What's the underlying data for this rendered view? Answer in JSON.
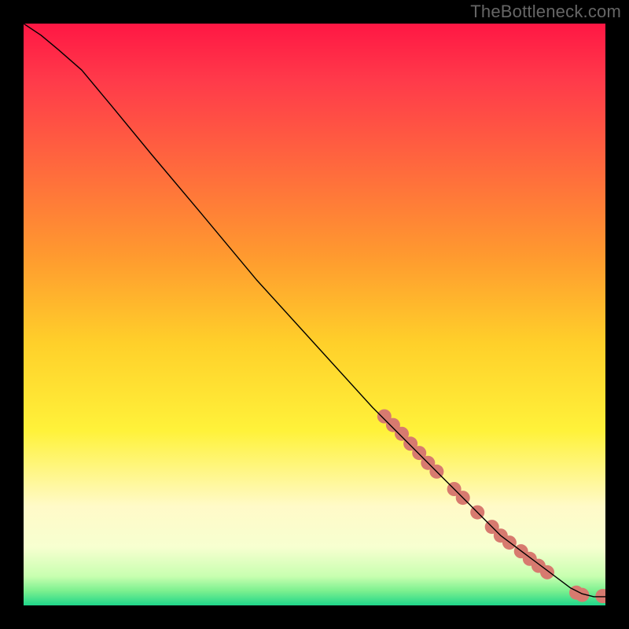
{
  "watermark": "TheBottleneck.com",
  "chart_data": {
    "type": "line",
    "title": "",
    "xlabel": "",
    "ylabel": "",
    "xlim": [
      0,
      100
    ],
    "ylim": [
      0,
      100
    ],
    "grid": false,
    "legend": false,
    "background_gradient": {
      "stops": [
        {
          "offset": 0.0,
          "color": "#ff1744"
        },
        {
          "offset": 0.1,
          "color": "#ff3b4a"
        },
        {
          "offset": 0.25,
          "color": "#ff6a3d"
        },
        {
          "offset": 0.4,
          "color": "#ff9a2f"
        },
        {
          "offset": 0.55,
          "color": "#ffd02a"
        },
        {
          "offset": 0.7,
          "color": "#fff23a"
        },
        {
          "offset": 0.83,
          "color": "#fffac8"
        },
        {
          "offset": 0.9,
          "color": "#f7ffd0"
        },
        {
          "offset": 0.95,
          "color": "#c8ffb0"
        },
        {
          "offset": 0.975,
          "color": "#7cf08f"
        },
        {
          "offset": 1.0,
          "color": "#1fd68a"
        }
      ]
    },
    "series": [
      {
        "name": "curve",
        "color": "#000000",
        "stroke_width": 1.4,
        "x": [
          0,
          3,
          6,
          10,
          15,
          22,
          30,
          40,
          50,
          60,
          68,
          72,
          75,
          78,
          80,
          82,
          84,
          86,
          88,
          90,
          92,
          94,
          96,
          98,
          100
        ],
        "y": [
          100,
          98,
          95.5,
          92,
          86,
          77.5,
          68,
          56,
          45,
          34,
          26,
          22,
          19,
          16,
          14,
          12,
          10.5,
          9,
          7.5,
          6,
          4.5,
          3,
          2,
          1.5,
          1.5
        ]
      }
    ],
    "markers": {
      "color": "#d77a6f",
      "radius": 9,
      "points": [
        {
          "x": 62,
          "y": 32.5
        },
        {
          "x": 63.5,
          "y": 31
        },
        {
          "x": 65,
          "y": 29.5
        },
        {
          "x": 66.5,
          "y": 27.8
        },
        {
          "x": 68,
          "y": 26.2
        },
        {
          "x": 69.5,
          "y": 24.5
        },
        {
          "x": 71,
          "y": 23
        },
        {
          "x": 74,
          "y": 20
        },
        {
          "x": 75.5,
          "y": 18.5
        },
        {
          "x": 78,
          "y": 16
        },
        {
          "x": 80.5,
          "y": 13.5
        },
        {
          "x": 82,
          "y": 12
        },
        {
          "x": 83.5,
          "y": 10.8
        },
        {
          "x": 85.5,
          "y": 9.3
        },
        {
          "x": 87,
          "y": 8
        },
        {
          "x": 88.5,
          "y": 6.8
        },
        {
          "x": 90,
          "y": 5.7
        },
        {
          "x": 95,
          "y": 2.2
        },
        {
          "x": 96,
          "y": 1.8
        },
        {
          "x": 99.5,
          "y": 1.6
        },
        {
          "x": 100,
          "y": 1.6
        }
      ]
    }
  }
}
